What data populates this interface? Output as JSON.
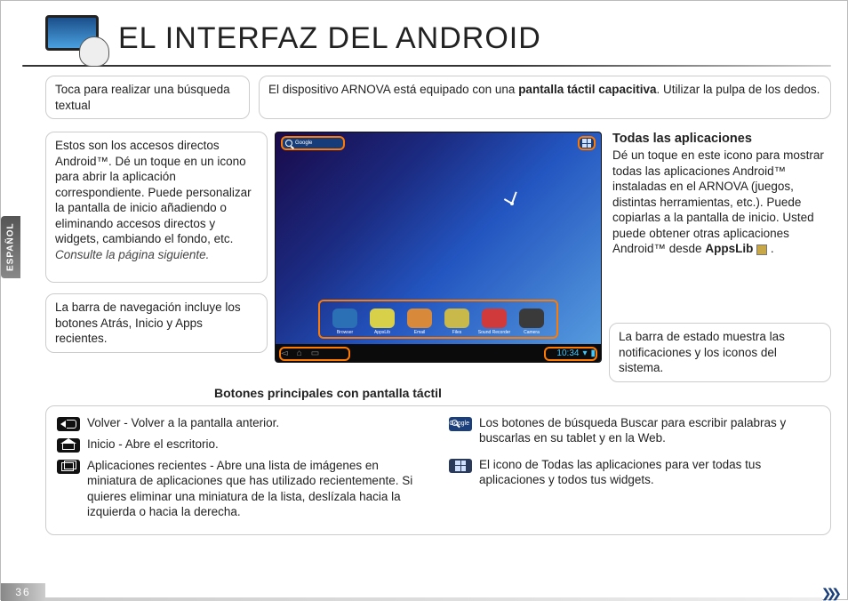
{
  "page": {
    "title": "EL INTERFAZ DEL ANDROID",
    "language_tab": "ESPAÑOL",
    "page_number": "36"
  },
  "callouts": {
    "search": "Toca para realizar una búsqueda textual",
    "intro_plain": "El dispositivo ARNOVA está equipado con una ",
    "intro_bold": "pantalla táctil capacitiva",
    "intro_tail": ". Utilizar la pulpa de los dedos.",
    "shortcuts_main": "Estos son los accesos directos Android™. Dé un toque en un icono para abrir la aplicación correspondiente. Puede personalizar la pantalla de inicio añadiendo o eliminando accesos directos y widgets, cambiando el fondo, etc. ",
    "shortcuts_italic": "Consulte la página siguiente.",
    "navbar": "La barra de navegación incluye los botones Atrás, Inicio y Apps recientes.",
    "allapps_title": "Todas las aplicaciones",
    "allapps_body": "Dé un toque en este icono para mostrar todas las aplicaciones Android™ instaladas en el ARNOVA (juegos, distintas herramientas, etc.). Puede copiarlas a la pantalla de inicio. Usted puede obtener otras aplicaciones Android™ desde ",
    "allapps_appslib": "AppsLib",
    "statusbar": "La barra de estado muestra las notificaciones y los iconos del sistema."
  },
  "screenshot": {
    "search_label": "Google",
    "time": "10:34",
    "dock": [
      {
        "label": "Browser",
        "color": "#2b6fb5"
      },
      {
        "label": "AppsLib",
        "color": "#d9d04a"
      },
      {
        "label": "Email",
        "color": "#d88a3a"
      },
      {
        "label": "Files",
        "color": "#c9b84a"
      },
      {
        "label": "Sound Recorder",
        "color": "#d03a3a"
      },
      {
        "label": "Camera",
        "color": "#3a3a3a"
      }
    ]
  },
  "bottom": {
    "heading": "Botones principales con pantalla táctil",
    "back": "Volver - Volver a la pantalla anterior.",
    "home": "Inicio - Abre el escritorio.",
    "recent": "Aplicaciones recientes - Abre una lista de imágenes en miniatura de aplicaciones que has utilizado recientemente. Si quieres eliminar una miniatura de la lista, deslízala hacia la izquierda o hacia la derecha.",
    "search": "Los botones de búsqueda Buscar para escribir palabras y buscarlas en su tablet y en la Web.",
    "allapps": "El icono de Todas las aplicaciones para ver todas tus aplicaciones y todos tus widgets.",
    "search_icon_label": "Google"
  }
}
